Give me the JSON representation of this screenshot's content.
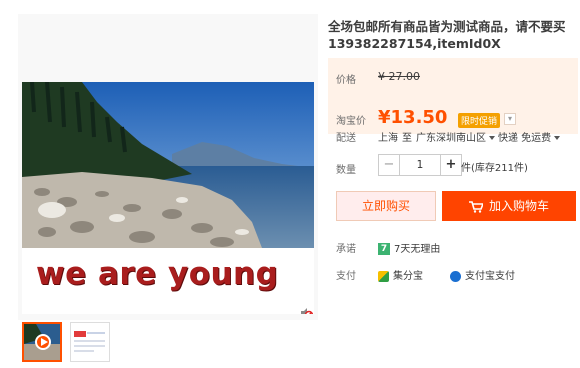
{
  "product": {
    "title": "全场包邮所有商品皆为测试商品，请不要买139382287154,itemId0X",
    "image_caption": "we are young"
  },
  "price": {
    "label": "价格",
    "original": "¥ 27.00"
  },
  "promo": {
    "label": "淘宝价",
    "price": "¥13.50",
    "badge": "限时促销",
    "expand": "▾"
  },
  "delivery": {
    "label": "配送",
    "from": "上海",
    "to_word": "至",
    "destination": "广东深圳南山区",
    "method": "快递 免运费"
  },
  "quantity": {
    "label": "数量",
    "minus": "−",
    "value": "1",
    "plus": "+",
    "stock": "件(库存211件)"
  },
  "buttons": {
    "buy_now": "立即购买",
    "add_to_cart": "加入购物车"
  },
  "promise": {
    "label": "承诺",
    "badge": "7",
    "text": "7天无理由"
  },
  "payment": {
    "label": "支付",
    "methods": [
      "集分宝",
      "支付宝支付"
    ]
  },
  "colors": {
    "accent": "#ff5000",
    "cart_button": "#ff4400",
    "price_box_bg": "#fff2e8",
    "badge": "#f4a000"
  },
  "icons": [
    "mute-icon",
    "play-icon",
    "cart-icon",
    "promise-icon",
    "jifenbao-icon",
    "alipay-icon"
  ]
}
